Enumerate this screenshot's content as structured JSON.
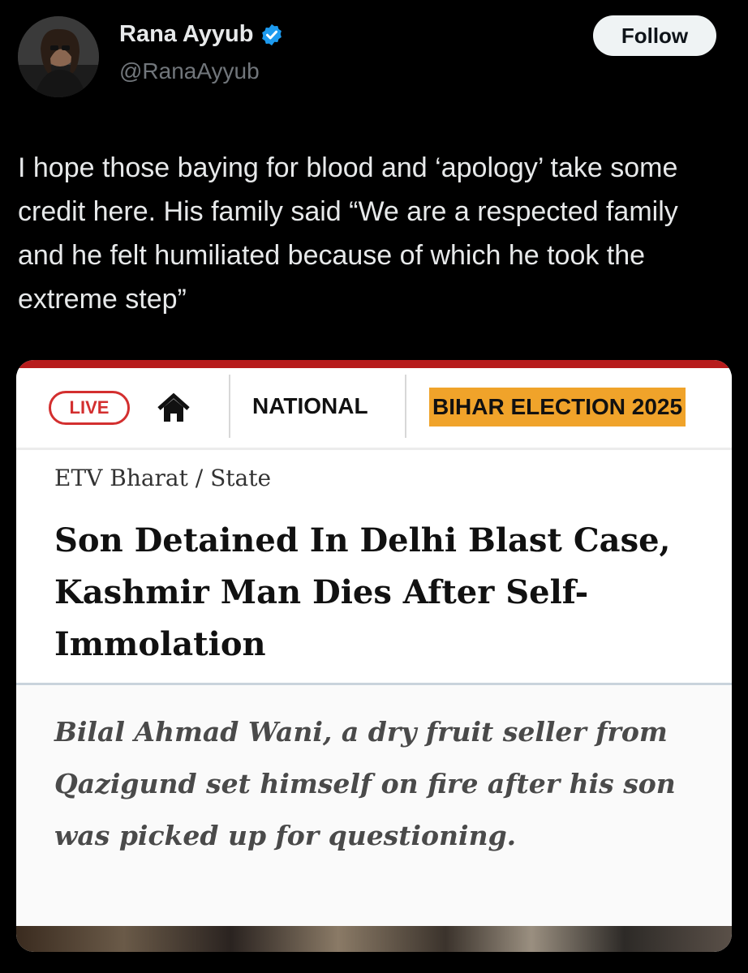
{
  "author": {
    "name": "Rana Ayyub",
    "handle": "@RanaAyyub",
    "verified": true,
    "avatar_icon": "avatar"
  },
  "follow_label": "Follow",
  "tweet_text": "I hope those baying for blood and ‘apology’ take some credit here. His family said “We are a respected family and he felt humiliated because of which he took the extreme step”",
  "media": {
    "nav": {
      "live_label": "LIVE",
      "home_icon": "home-icon",
      "national_label": "NATIONAL",
      "bihar_label": "BIHAR ELECTION 2025"
    },
    "breadcrumb": "ETV Bharat / State",
    "headline": "Son Detained In Delhi Blast Case, Kashmir Man Dies After Self-Immolation",
    "summary": "Bilal Ahmad Wani, a dry fruit seller from Qazigund set himself on fire after his son was picked up for questioning."
  },
  "colors": {
    "accent_red": "#d32f2f",
    "highlight_orange": "#f0a32a",
    "verified_blue": "#1d9bf0"
  }
}
